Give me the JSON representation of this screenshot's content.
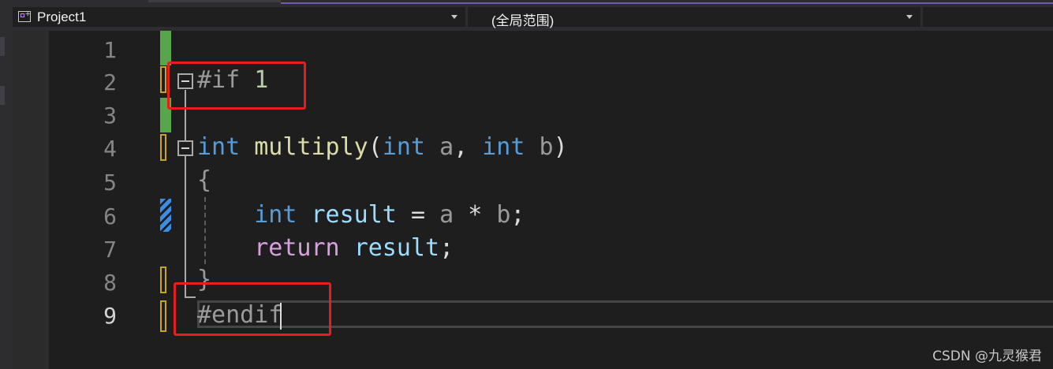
{
  "navigation_bar": {
    "project_combo": {
      "label": "Project1",
      "icon": "project-icon"
    },
    "scope_combo": {
      "label": "(全局范围)"
    }
  },
  "editor": {
    "line_numbers": [
      "1",
      "2",
      "3",
      "4",
      "5",
      "6",
      "7",
      "8",
      "9"
    ],
    "current_line": 9,
    "code": {
      "line2": {
        "directive": "#if",
        "value": "1"
      },
      "line4": {
        "ret_type": "int",
        "func_name": "multiply",
        "open_paren": "(",
        "p1_type": "int",
        "p1_name": "a",
        "comma": ",",
        "p2_type": "int",
        "p2_name": "b",
        "close_paren": ")"
      },
      "line5": {
        "brace_open": "{"
      },
      "line6": {
        "type": "int",
        "var": "result",
        "eq": "=",
        "a": "a",
        "op": "*",
        "b": "b",
        "semi": ";"
      },
      "line7": {
        "keyword": "return",
        "var": "result",
        "semi": ";"
      },
      "line8": {
        "brace_close": "}"
      },
      "line9": {
        "directive": "#endif"
      }
    },
    "colors": {
      "keyword": "#569cd6",
      "function": "#dcdcaa",
      "variable": "#9cdcfe",
      "control": "#d8a0df",
      "preprocessor": "#9b9b9b",
      "highlight_box": "#e81e1e",
      "change_saved": "#57a64a",
      "change_unsaved": "#c8a520"
    }
  },
  "watermark": {
    "text": "CSDN @九灵猴君"
  }
}
